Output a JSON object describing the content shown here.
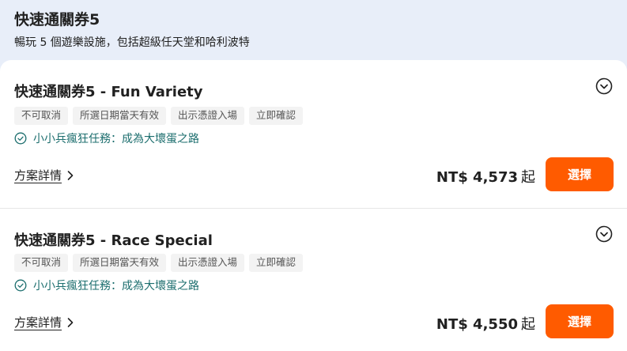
{
  "header": {
    "title": "快速通關券5",
    "subtitle": "暢玩 5 個遊樂設施，包括超級任天堂和哈利波特"
  },
  "accent_color": "#ff5b00",
  "activity_color": "#1c6e6e",
  "options": [
    {
      "title": "快速通關券5 - Fun Variety",
      "tags": [
        "不可取消",
        "所選日期當天有效",
        "出示憑證入場",
        "立即確認"
      ],
      "activity": "小小兵瘋狂任務：成為大壞蛋之路",
      "details_label": "方案詳情",
      "price": "NT$ 4,573",
      "price_suffix": "起",
      "button_label": "選擇"
    },
    {
      "title": "快速通關券5 - Race Special",
      "tags": [
        "不可取消",
        "所選日期當天有效",
        "出示憑證入場",
        "立即確認"
      ],
      "activity": "小小兵瘋狂任務：成為大壞蛋之路",
      "details_label": "方案詳情",
      "price": "NT$ 4,550",
      "price_suffix": "起",
      "button_label": "選擇"
    }
  ]
}
